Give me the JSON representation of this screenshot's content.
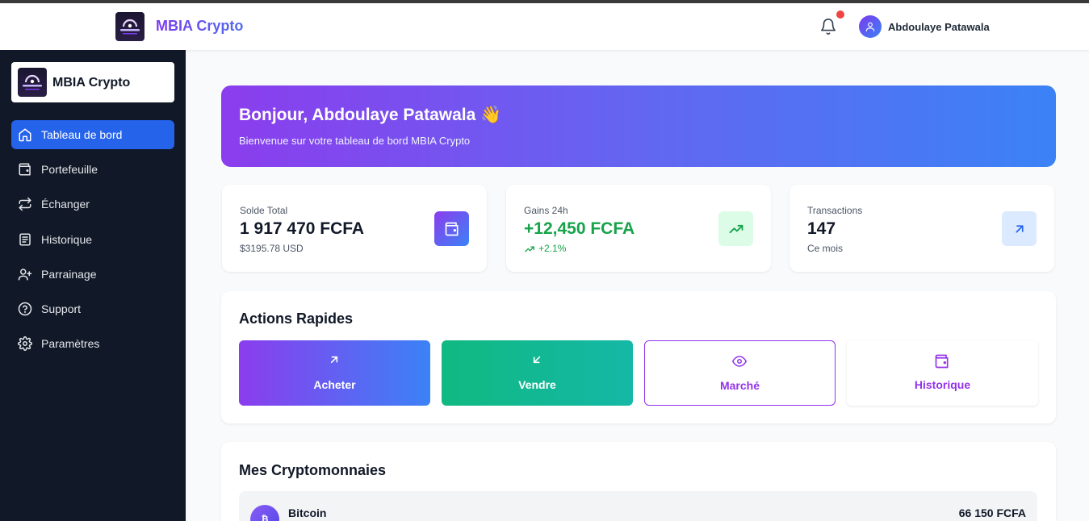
{
  "header": {
    "brand": "MBIA Crypto",
    "username": "Abdoulaye Patawala",
    "has_notification": true
  },
  "sidebar": {
    "brand": "MBIA Crypto",
    "items": [
      {
        "label": "Tableau de bord",
        "icon": "home-icon",
        "active": true
      },
      {
        "label": "Portefeuille",
        "icon": "wallet-icon",
        "active": false
      },
      {
        "label": "Échanger",
        "icon": "swap-icon",
        "active": false
      },
      {
        "label": "Historique",
        "icon": "history-icon",
        "active": false
      },
      {
        "label": "Parrainage",
        "icon": "user-plus-icon",
        "active": false
      },
      {
        "label": "Support",
        "icon": "help-icon",
        "active": false
      },
      {
        "label": "Paramètres",
        "icon": "gear-icon",
        "active": false
      }
    ]
  },
  "hero": {
    "title": "Bonjour, Abdoulaye Patawala 👋",
    "subtitle": "Bienvenue sur votre tableau de bord MBIA Crypto"
  },
  "stats": [
    {
      "label": "Solde Total",
      "value": "1 917 470 FCFA",
      "sub": "$3195.78 USD",
      "icon": "wallet-icon"
    },
    {
      "label": "Gains 24h",
      "value": "+12,450 FCFA",
      "sub": "+2.1%",
      "icon": "trending-up-icon"
    },
    {
      "label": "Transactions",
      "value": "147",
      "sub": "Ce mois",
      "icon": "arrow-up-right-icon"
    }
  ],
  "quick_actions": {
    "title": "Actions Rapides",
    "buttons": [
      {
        "label": "Acheter",
        "icon": "arrow-up-right-icon"
      },
      {
        "label": "Vendre",
        "icon": "arrow-down-left-icon"
      },
      {
        "label": "Marché",
        "icon": "eye-icon"
      },
      {
        "label": "Historique",
        "icon": "wallet-icon"
      }
    ]
  },
  "cryptos": {
    "title": "Mes Cryptomonnaies",
    "items": [
      {
        "name": "Bitcoin",
        "value": "66 150 FCFA"
      }
    ]
  },
  "colors": {
    "accent_purple": "#7c3aed",
    "accent_blue": "#3b82f6",
    "sidebar_bg": "#111827",
    "active_nav": "#2563eb",
    "success": "#16a34a",
    "notification": "#ef4444"
  }
}
